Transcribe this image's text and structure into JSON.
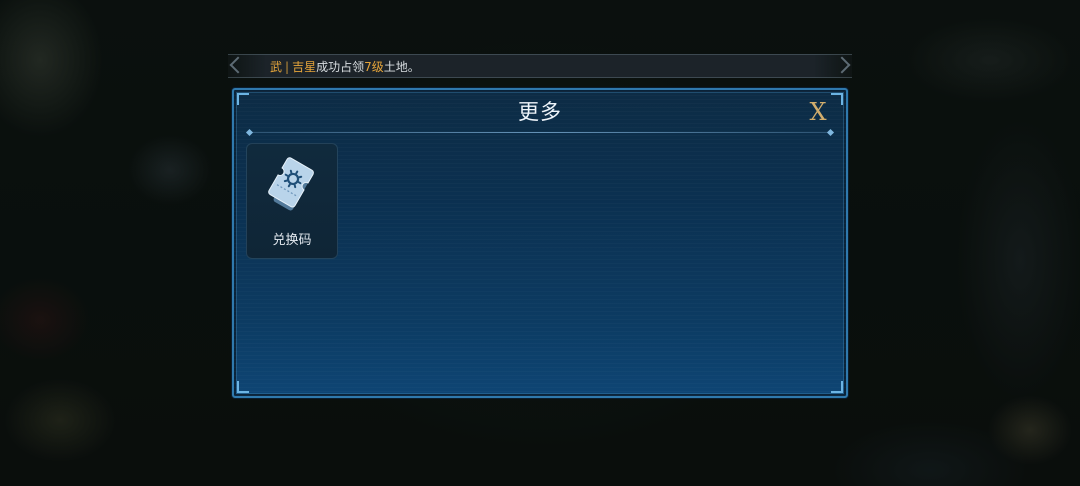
{
  "notice": {
    "player_name": "武",
    "separator": "|",
    "server_name": "吉星",
    "action_text": "成功占领",
    "level_text": "7级",
    "suffix_text": "土地。"
  },
  "dialog": {
    "title": "更多",
    "close_label": "X"
  },
  "tiles": [
    {
      "label": "兑换码",
      "icon": "ticket-icon"
    }
  ],
  "colors": {
    "accent_gold": "#e6a53a",
    "panel_border": "#2f79ad",
    "close_gold": "#d2ad6c"
  }
}
